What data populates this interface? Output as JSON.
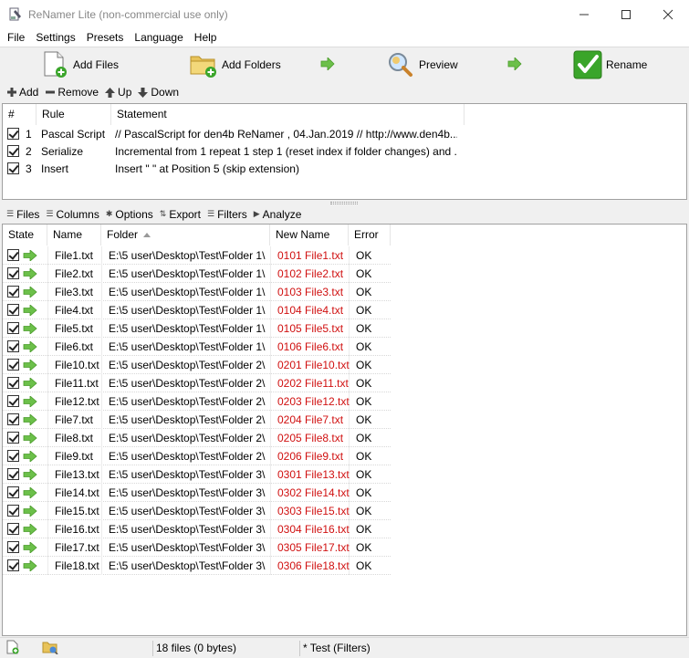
{
  "window": {
    "title": "ReNamer Lite (non-commercial use only)",
    "minimize_icon": "minimize-icon",
    "maximize_icon": "maximize-icon",
    "close_icon": "close-icon"
  },
  "menu": [
    "File",
    "Settings",
    "Presets",
    "Language",
    "Help"
  ],
  "toolbar": {
    "add_files": "Add Files",
    "add_folders": "Add Folders",
    "preview": "Preview",
    "rename": "Rename"
  },
  "rules_toolbar": {
    "add": "Add",
    "remove": "Remove",
    "up": "Up",
    "down": "Down"
  },
  "rules": {
    "columns": [
      "#",
      "Rule",
      "Statement"
    ],
    "rows": [
      {
        "num": "1",
        "rule": "Pascal Script",
        "statement": "// PascalScript for den4b ReNamer , 04.Jan.2019 // http://www.den4b...",
        "checked": true
      },
      {
        "num": "2",
        "rule": "Serialize",
        "statement": "Incremental from 1 repeat 1 step 1 (reset index if folder changes) and ...",
        "checked": true
      },
      {
        "num": "3",
        "rule": "Insert",
        "statement": "Insert \" \" at Position 5 (skip extension)",
        "checked": true
      }
    ]
  },
  "files_toolbar": [
    "Files",
    "Columns",
    "Options",
    "Export",
    "Filters",
    "Analyze"
  ],
  "files": {
    "columns": [
      "State",
      "Name",
      "Folder",
      "New Name",
      "Error"
    ],
    "sorted_column": "Folder",
    "rows": [
      {
        "name": "File1.txt",
        "folder": "E:\\5 user\\Desktop\\Test\\Folder 1\\",
        "new_name": "0101 File1.txt",
        "error": "OK"
      },
      {
        "name": "File2.txt",
        "folder": "E:\\5 user\\Desktop\\Test\\Folder 1\\",
        "new_name": "0102 File2.txt",
        "error": "OK"
      },
      {
        "name": "File3.txt",
        "folder": "E:\\5 user\\Desktop\\Test\\Folder 1\\",
        "new_name": "0103 File3.txt",
        "error": "OK"
      },
      {
        "name": "File4.txt",
        "folder": "E:\\5 user\\Desktop\\Test\\Folder 1\\",
        "new_name": "0104 File4.txt",
        "error": "OK"
      },
      {
        "name": "File5.txt",
        "folder": "E:\\5 user\\Desktop\\Test\\Folder 1\\",
        "new_name": "0105 File5.txt",
        "error": "OK"
      },
      {
        "name": "File6.txt",
        "folder": "E:\\5 user\\Desktop\\Test\\Folder 1\\",
        "new_name": "0106 File6.txt",
        "error": "OK"
      },
      {
        "name": "File10.txt",
        "folder": "E:\\5 user\\Desktop\\Test\\Folder 2\\",
        "new_name": "0201 File10.txt",
        "error": "OK"
      },
      {
        "name": "File11.txt",
        "folder": "E:\\5 user\\Desktop\\Test\\Folder 2\\",
        "new_name": "0202 File11.txt",
        "error": "OK"
      },
      {
        "name": "File12.txt",
        "folder": "E:\\5 user\\Desktop\\Test\\Folder 2\\",
        "new_name": "0203 File12.txt",
        "error": "OK"
      },
      {
        "name": "File7.txt",
        "folder": "E:\\5 user\\Desktop\\Test\\Folder 2\\",
        "new_name": "0204 File7.txt",
        "error": "OK"
      },
      {
        "name": "File8.txt",
        "folder": "E:\\5 user\\Desktop\\Test\\Folder 2\\",
        "new_name": "0205 File8.txt",
        "error": "OK"
      },
      {
        "name": "File9.txt",
        "folder": "E:\\5 user\\Desktop\\Test\\Folder 2\\",
        "new_name": "0206 File9.txt",
        "error": "OK"
      },
      {
        "name": "File13.txt",
        "folder": "E:\\5 user\\Desktop\\Test\\Folder 3\\",
        "new_name": "0301 File13.txt",
        "error": "OK"
      },
      {
        "name": "File14.txt",
        "folder": "E:\\5 user\\Desktop\\Test\\Folder 3\\",
        "new_name": "0302 File14.txt",
        "error": "OK"
      },
      {
        "name": "File15.txt",
        "folder": "E:\\5 user\\Desktop\\Test\\Folder 3\\",
        "new_name": "0303 File15.txt",
        "error": "OK"
      },
      {
        "name": "File16.txt",
        "folder": "E:\\5 user\\Desktop\\Test\\Folder 3\\",
        "new_name": "0304 File16.txt",
        "error": "OK"
      },
      {
        "name": "File17.txt",
        "folder": "E:\\5 user\\Desktop\\Test\\Folder 3\\",
        "new_name": "0305 File17.txt",
        "error": "OK"
      },
      {
        "name": "File18.txt",
        "folder": "E:\\5 user\\Desktop\\Test\\Folder 3\\",
        "new_name": "0306 File18.txt",
        "error": "OK"
      }
    ]
  },
  "status": {
    "file_count": "18 files (0 bytes)",
    "preset": "* Test (Filters)"
  },
  "colors": {
    "new_name": "#d01010",
    "rename_green": "#3aa52a",
    "arrow_green": "#6cc04a"
  }
}
